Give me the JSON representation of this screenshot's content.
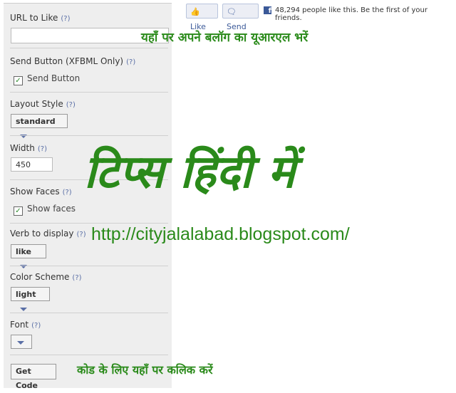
{
  "panel": {
    "url_label": "URL to Like",
    "help": "(?)",
    "send_label": "Send Button (XFBML Only)",
    "send_checkbox": "Send Button",
    "send_checked": true,
    "layout_label": "Layout Style",
    "layout_value": "standard",
    "width_label": "Width",
    "width_value": "450",
    "faces_label": "Show Faces",
    "faces_checkbox": "Show faces",
    "faces_checked": true,
    "verb_label": "Verb to display",
    "verb_value": "like",
    "color_label": "Color Scheme",
    "color_value": "light",
    "font_label": "Font",
    "font_value": "",
    "get_code": "Get Code"
  },
  "preview": {
    "like": "Like",
    "send": "Send",
    "count_text": "48,294 people like this. Be the first of your friends."
  },
  "overlay": {
    "url_hint": "यहाँ पर अपने बलॉग का यूआरएल भरें",
    "title": "टिप्स हिंदी में",
    "blog_url": "http://cityjalalabad.blogspot.com/",
    "code_hint": "कोड के लिए यहाँ पर कलिक करें"
  },
  "colors": {
    "green": "#2a8a1a",
    "fb_blue": "#3b5998"
  }
}
